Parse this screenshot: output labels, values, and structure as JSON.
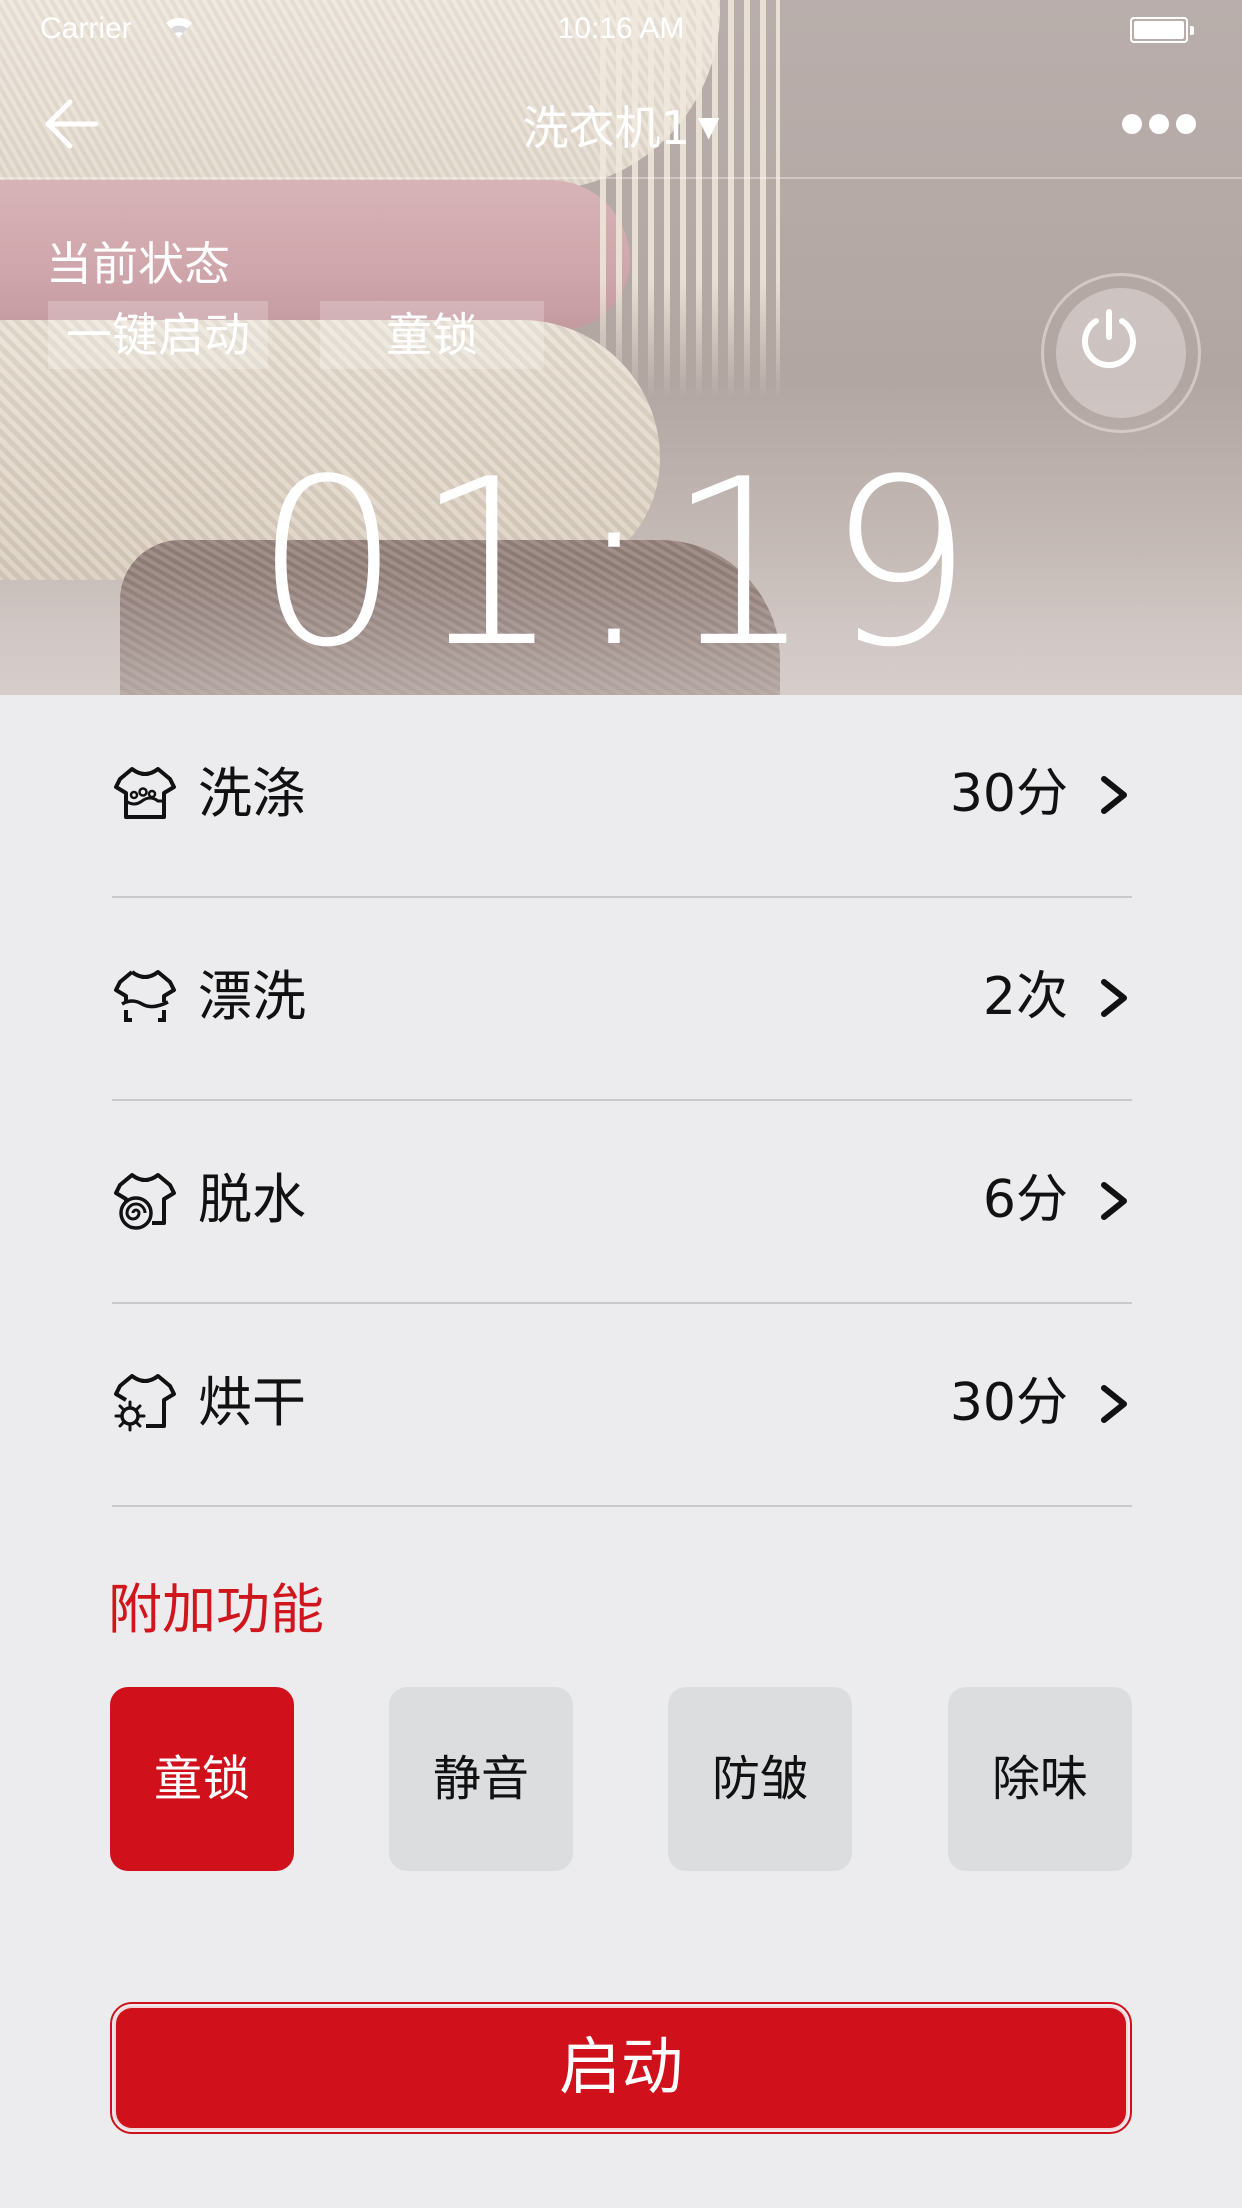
{
  "status_bar": {
    "carrier": "Carrier",
    "time": "10:16 AM",
    "wifi_icon": "wifi-icon",
    "battery_icon": "battery-icon"
  },
  "nav": {
    "back_icon": "arrow-left-icon",
    "title": "洗衣机1",
    "title_caret": "▼",
    "more_icon": "more-dots-icon"
  },
  "current_state": {
    "label": "当前状态",
    "chips": [
      "一键启动",
      "童锁"
    ]
  },
  "power_icon": "power-icon",
  "timer": "01:19",
  "settings": [
    {
      "icon": "shirt-wash-icon",
      "label": "洗涤",
      "value": "30分"
    },
    {
      "icon": "shirt-rinse-icon",
      "label": "漂洗",
      "value": "2次"
    },
    {
      "icon": "shirt-spin-icon",
      "label": "脱水",
      "value": "6分"
    },
    {
      "icon": "shirt-dry-icon",
      "label": "烘干",
      "value": "30分"
    }
  ],
  "extras": {
    "title": "附加功能",
    "options": [
      {
        "label": "童锁",
        "active": true
      },
      {
        "label": "静音",
        "active": false
      },
      {
        "label": "防皱",
        "active": false
      },
      {
        "label": "除味",
        "active": false
      }
    ]
  },
  "start_button": "启动",
  "colors": {
    "accent": "#d0111b",
    "background": "#ececee",
    "option_inactive": "#dcddde"
  }
}
